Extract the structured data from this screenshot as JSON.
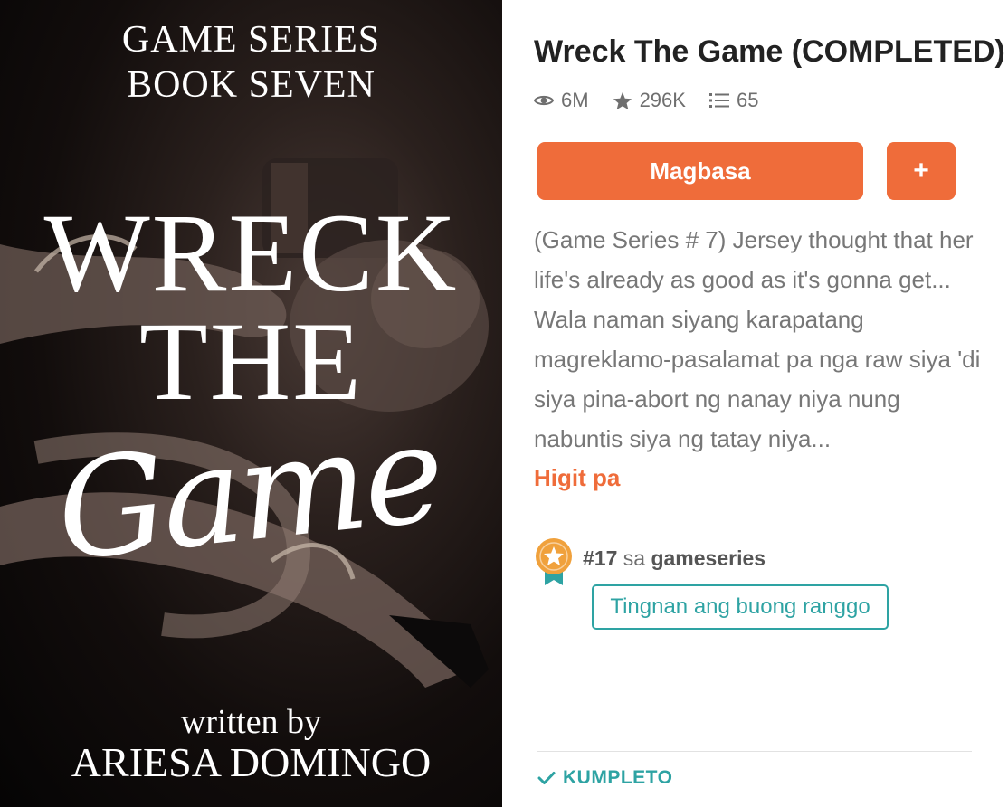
{
  "cover": {
    "series_line1": "GAME SERIES",
    "series_line2": "BOOK SEVEN",
    "title_word1": "WRECK",
    "title_word2": "THE",
    "title_script": "Game",
    "written_by": "written by",
    "author": "ARIESA DOMINGO"
  },
  "story": {
    "title": "Wreck The Game (COMPLETED)",
    "stats": {
      "reads": "6M",
      "reads_icon": "eye-icon",
      "votes": "296K",
      "votes_icon": "star-icon",
      "parts": "65",
      "parts_icon": "list-icon"
    },
    "read_button": "Magbasa",
    "add_button": "+",
    "description": "(Game Series # 7) Jersey thought that her life's already as good as it's gonna get... Wala naman siyang karapatang magreklamo-pasalamat pa nga raw siya 'di siya pina-abort ng nanay niya nung nabuntis siya ng tatay niya...",
    "more_link": "Higit pa",
    "ranking": {
      "rank": "#17",
      "connector": " sa ",
      "tag": "gameseries",
      "badge_icon": "ribbon-star-icon",
      "view_all_button": "Tingnan ang buong ranggo"
    },
    "status": {
      "icon": "check-icon",
      "label": "KUMPLETO"
    }
  },
  "colors": {
    "accent": "#ef6c3a",
    "teal": "#2ea3a3",
    "badge": "#f0a13c"
  }
}
